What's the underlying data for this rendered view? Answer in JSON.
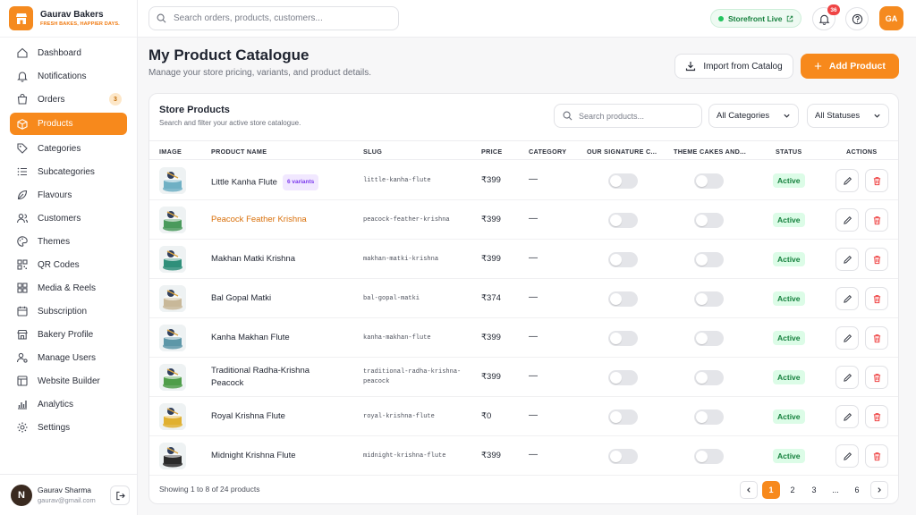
{
  "brand": {
    "name": "Gaurav Bakers",
    "tagline": "FRESH BAKES, HAPPIER DAYS."
  },
  "sidebar": {
    "items": [
      {
        "label": "Dashboard",
        "icon": "home-icon"
      },
      {
        "label": "Notifications",
        "icon": "bell-icon"
      },
      {
        "label": "Orders",
        "icon": "bag-icon",
        "badge": "3"
      },
      {
        "label": "Products",
        "icon": "box-icon",
        "active": true
      },
      {
        "label": "Categories",
        "icon": "tag-icon"
      },
      {
        "label": "Subcategories",
        "icon": "list-icon"
      },
      {
        "label": "Flavours",
        "icon": "leaf-icon"
      },
      {
        "label": "Customers",
        "icon": "users-icon"
      },
      {
        "label": "Themes",
        "icon": "palette-icon"
      },
      {
        "label": "QR Codes",
        "icon": "qr-icon"
      },
      {
        "label": "Media & Reels",
        "icon": "media-icon"
      },
      {
        "label": "Subscription",
        "icon": "calendar-icon"
      },
      {
        "label": "Bakery Profile",
        "icon": "store-icon"
      },
      {
        "label": "Manage Users",
        "icon": "user-cog-icon"
      },
      {
        "label": "Website Builder",
        "icon": "layout-icon"
      },
      {
        "label": "Analytics",
        "icon": "chart-icon"
      },
      {
        "label": "Settings",
        "icon": "gear-icon"
      }
    ],
    "user": {
      "initial": "N",
      "name": "Gaurav Sharma",
      "email": "gaurav@gmail.com"
    }
  },
  "topbar": {
    "search_placeholder": "Search orders, products, customers...",
    "storefront_label": "Storefront Live",
    "notification_count": "36",
    "avatar_initials": "GA"
  },
  "page": {
    "title": "My Product Catalogue",
    "subtitle": "Manage your store pricing, variants, and product details.",
    "import_label": "Import from Catalog",
    "add_label": "Add Product"
  },
  "card": {
    "title": "Store Products",
    "subtitle": "Search and filter your active store catalogue.",
    "search_placeholder": "Search products...",
    "category_filter": "All Categories",
    "status_filter": "All Statuses"
  },
  "columns": {
    "image": "IMAGE",
    "name": "PRODUCT NAME",
    "slug": "SLUG",
    "price": "PRICE",
    "category": "CATEGORY",
    "signature": "OUR SIGNATURE C...",
    "theme": "THEME CAKES AND...",
    "status": "STATUS",
    "actions": "ACTIONS"
  },
  "products": [
    {
      "name": "Little Kanha Flute",
      "variants": "6 variants",
      "slug": "little-kanha-flute",
      "price": "₹399",
      "category": "—",
      "status": "Active",
      "signature_on": false,
      "theme_on": false,
      "thumb": "#6fb0c4"
    },
    {
      "name": "Peacock Feather Krishna",
      "slug": "peacock-feather-krishna",
      "price": "₹399",
      "category": "—",
      "status": "Active",
      "signature_on": false,
      "theme_on": false,
      "thumb": "#4a9a5c",
      "highlight": true
    },
    {
      "name": "Makhan Matki Krishna",
      "slug": "makhan-matki-krishna",
      "price": "₹399",
      "category": "—",
      "status": "Active",
      "signature_on": false,
      "theme_on": false,
      "thumb": "#2f8f7a"
    },
    {
      "name": "Bal Gopal Matki",
      "slug": "bal-gopal-matki",
      "price": "₹374",
      "category": "—",
      "status": "Active",
      "signature_on": false,
      "theme_on": false,
      "thumb": "#c8b899"
    },
    {
      "name": "Kanha Makhan Flute",
      "slug": "kanha-makhan-flute",
      "price": "₹399",
      "category": "—",
      "status": "Active",
      "signature_on": false,
      "theme_on": false,
      "thumb": "#5d97a8"
    },
    {
      "name": "Traditional Radha-Krishna Peacock",
      "slug": "traditional-radha-krishna-peacock",
      "price": "₹399",
      "category": "—",
      "status": "Active",
      "signature_on": false,
      "theme_on": false,
      "thumb": "#4f9e4a"
    },
    {
      "name": "Royal Krishna Flute",
      "slug": "royal-krishna-flute",
      "price": "₹0",
      "category": "—",
      "status": "Active",
      "signature_on": false,
      "theme_on": false,
      "thumb": "#e0b030"
    },
    {
      "name": "Midnight Krishna Flute",
      "slug": "midnight-krishna-flute",
      "price": "₹399",
      "category": "—",
      "status": "Active",
      "signature_on": false,
      "theme_on": false,
      "thumb": "#2a2a2a"
    }
  ],
  "pagination": {
    "summary": "Showing 1 to 8 of 24 products",
    "pages": [
      "1",
      "2",
      "3",
      "...",
      "6"
    ],
    "current": "1"
  },
  "colors": {
    "accent": "#f7891c",
    "active_green": "#15803d",
    "delete_red": "#ef4444"
  }
}
